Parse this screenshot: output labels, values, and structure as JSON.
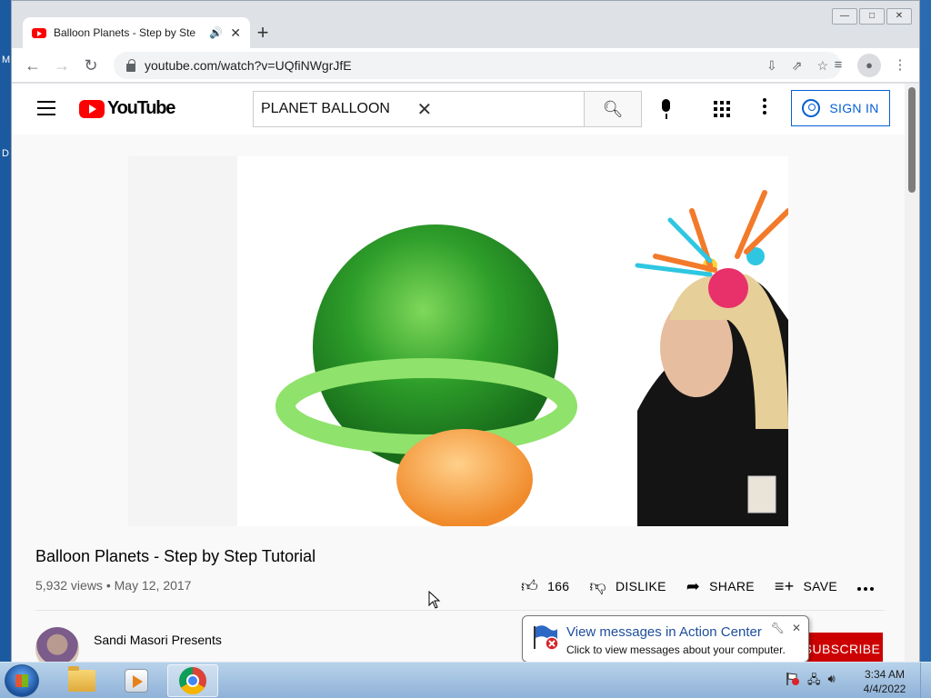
{
  "desktop": {
    "edge_letters": [
      "M",
      "D"
    ]
  },
  "browser": {
    "tab": {
      "title": "Balloon Planets - Step by Ste",
      "audio_icon": "speaker-icon"
    },
    "url": "youtube.com/watch?v=UQfiNWgrJfE",
    "window_controls": {
      "minimize": "—",
      "maximize": "□",
      "close": "✕"
    }
  },
  "youtube": {
    "logo_text": "YouTube",
    "search_query": "PLANET BALLOON",
    "signin_label": "SIGN IN",
    "video": {
      "title": "Balloon Planets - Step by Step Tutorial",
      "views": "5,932 views",
      "date": "May 12, 2017",
      "likes": "166",
      "dislike_label": "DISLIKE",
      "share_label": "SHARE",
      "save_label": "SAVE"
    },
    "channel": {
      "name": "Sandi Masori Presents",
      "subscribe_label": "SUBSCRIBE"
    }
  },
  "notification": {
    "title": "View messages in Action Center",
    "text": "Click to view messages about your computer."
  },
  "taskbar": {
    "time": "3:34 AM",
    "date": "4/4/2022",
    "colors": {
      "accent": "#065fd4",
      "subscribe": "#cc0000"
    }
  }
}
